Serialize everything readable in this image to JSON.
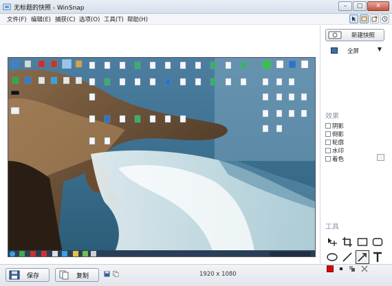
{
  "window": {
    "title": "无标题的快照 - WinSnap",
    "buttons": [
      "–",
      "□",
      "✕"
    ]
  },
  "menu": [
    "文件(F)",
    "编辑(E)",
    "捕获(C)",
    "选项(O)",
    "工具(T)",
    "帮助(H)"
  ],
  "toolbar_icons": [
    "pointer-icon",
    "window-icon",
    "export-icon",
    "timer-icon"
  ],
  "preview": {
    "dimensions": "1920 x 1080"
  },
  "bottom": {
    "save_label": "保存",
    "copy_label": "复制"
  },
  "panel": {
    "new_snapshot_label": "新建快照",
    "mode_label": "全屏",
    "effects_title": "效果",
    "effects": [
      {
        "label": "阴影",
        "checked": false
      },
      {
        "label": "倒影",
        "checked": false
      },
      {
        "label": "轮廓",
        "checked": false
      },
      {
        "label": "水印",
        "checked": false
      },
      {
        "label": "着色",
        "checked": false
      }
    ],
    "tools_title": "工具",
    "tools": [
      "move-icon",
      "crop-icon",
      "rectangle-icon",
      "rounded-rectangle-icon",
      "ellipse-icon",
      "line-icon",
      "arrow-icon",
      "text-icon"
    ],
    "selected_tool": "arrow-icon",
    "colors": {
      "primary": "#e00000",
      "accent": "#3b6ea8"
    }
  }
}
